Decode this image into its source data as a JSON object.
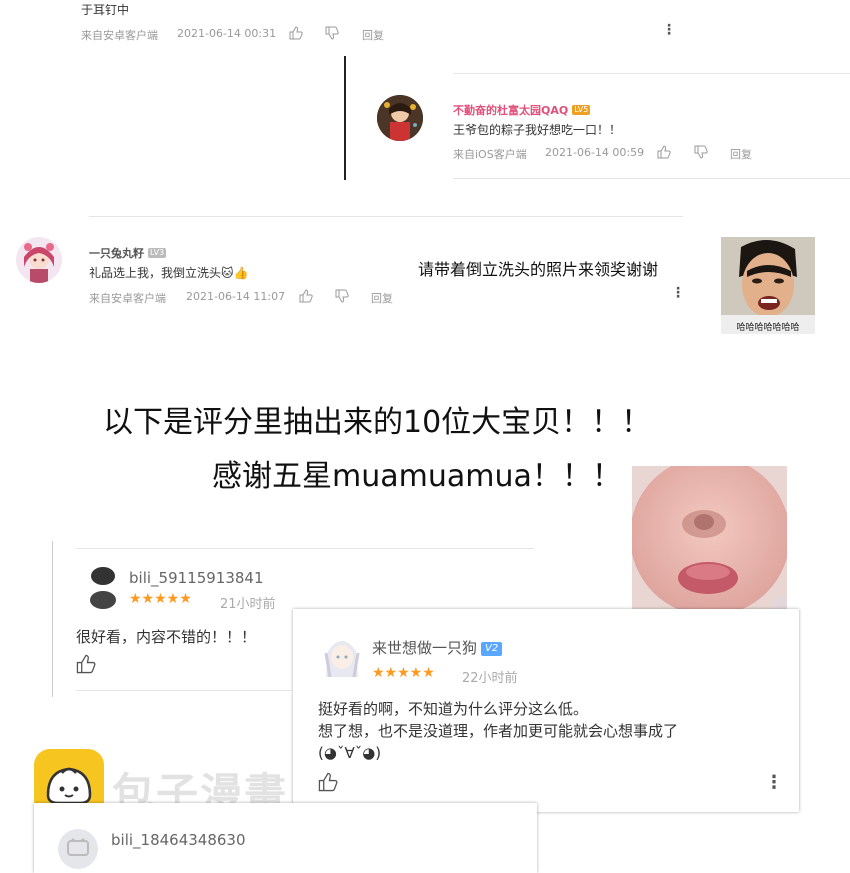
{
  "top_comment": {
    "text": "于耳钉中",
    "source": "来自安卓客户端",
    "time": "2021-06-14 00:31",
    "reply": "回复"
  },
  "reply_comment": {
    "username": "不勤奋的杜富太园QAQ",
    "level": "LV5",
    "text": "王爷包的粽子我好想吃一口！！",
    "source": "来自iOS客户端",
    "time": "2021-06-14 00:59",
    "reply": "回复"
  },
  "second_comment": {
    "username": "一只兔丸籽",
    "level": "LV3",
    "text": "礼品选上我，我倒立洗头",
    "emoji": "🐱👍",
    "source": "来自安卓客户端",
    "time": "2021-06-14 11:07",
    "reply": "回复"
  },
  "caption_right": "请带着倒立洗头的照片来领奖谢谢",
  "meme_caption": "哈哈哈哈哈哈哈",
  "headline_1": "以下是评分里抽出来的10位大宝贝！！！",
  "headline_2": "感谢五星muamuamua！！！",
  "review_1": {
    "username": "bili_59115913841",
    "stars": "★★★★★",
    "time": "21小时前",
    "text": "很好看，内容不错的！！！"
  },
  "review_2": {
    "username": "来世想做一只狗",
    "badge": "V2",
    "stars": "★★★★★",
    "time": "22小时前",
    "text_lines": [
      "挺好看的啊，不知道为什么评分这么低。",
      "想了想，也不是没道理，作者加更可能就会心想事成了",
      "(◕ˇ∀ˇ◕)"
    ]
  },
  "review_3": {
    "username": "bili_18464348630"
  },
  "watermark": "包子漫畫",
  "colors": {
    "pink_name": "#e0507a",
    "star": "#ff9a1f",
    "badge_blue": "#5aa7ff",
    "logo_yellow": "#f7c520"
  }
}
